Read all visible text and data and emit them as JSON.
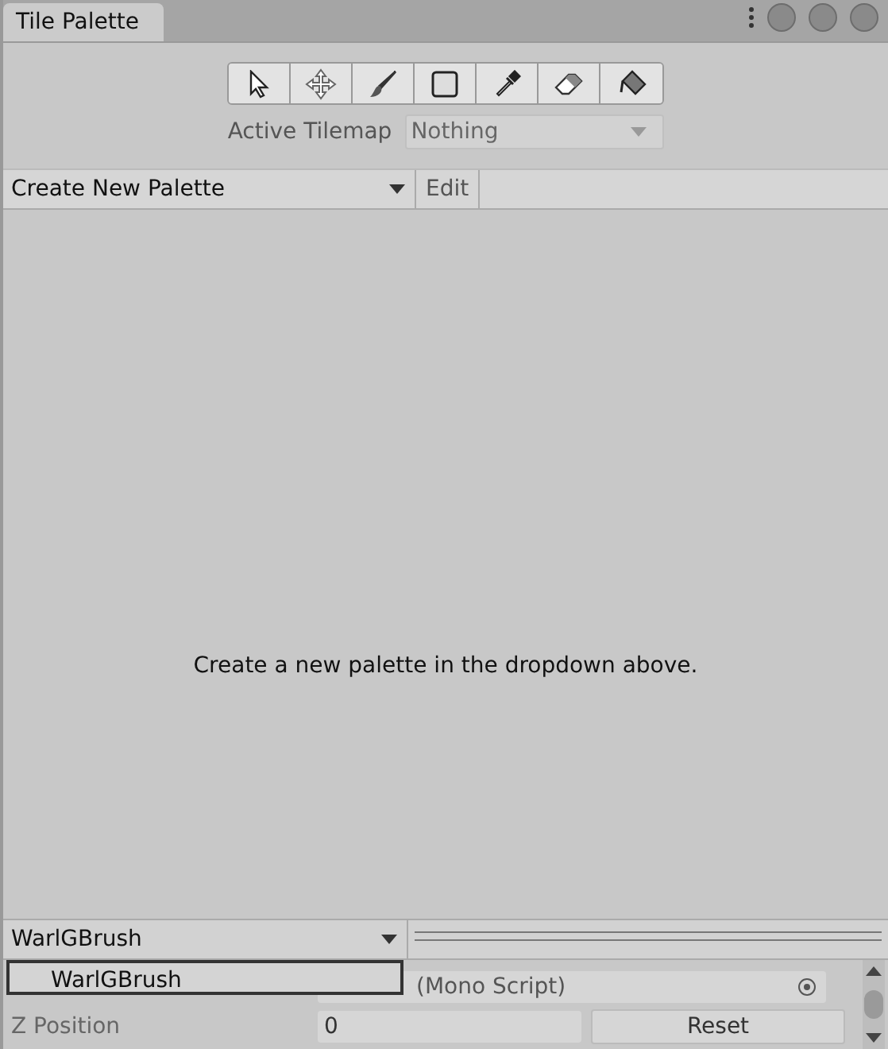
{
  "window": {
    "title": "Tile Palette"
  },
  "tools": [
    {
      "kind": "select"
    },
    {
      "kind": "move"
    },
    {
      "kind": "paint"
    },
    {
      "kind": "box"
    },
    {
      "kind": "picker"
    },
    {
      "kind": "erase"
    },
    {
      "kind": "fill"
    }
  ],
  "active_tilemap": {
    "label": "Active Tilemap",
    "value": "Nothing"
  },
  "palette_bar": {
    "dropdown": "Create New Palette",
    "edit": "Edit"
  },
  "message": "Create a new palette in the dropdown above.",
  "brush": {
    "dropdown": "WarlGBrush",
    "popup_item": "WarlGBrush"
  },
  "inspector": {
    "script_value": "(Mono Script)",
    "z_label": "Z Position",
    "z_value": "0",
    "reset": "Reset"
  }
}
